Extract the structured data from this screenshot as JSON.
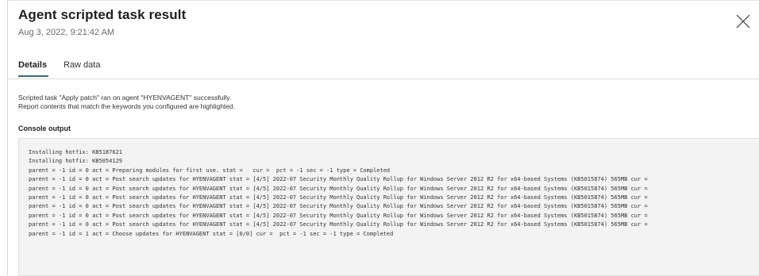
{
  "dialog": {
    "title": "Agent scripted task result",
    "timestamp": "Aug 3, 2022, 9:21:42 AM",
    "close_icon": "close-icon"
  },
  "tabs": [
    {
      "label": "Details",
      "active": true
    },
    {
      "label": "Raw data",
      "active": false
    }
  ],
  "details": {
    "message_line1": "Scripted task \"Apply patch\" ran on agent \"HYENVAGENT\" successfully.",
    "message_line2": "Report contents that match the keywords you configured are highlighted.",
    "console_label": "Console output",
    "console_lines": [
      "Installing hotfix: KB5187621",
      "Installing hotfix: KB5054129",
      "parent = -1 id = 0 act = Preparing modules for first use. stat =   cur =  pct = -1 sec = -1 type = Completed",
      "parent = -1 id = 0 act = Post search updates for HYENVAGENT stat = [4/5] 2022-07 Security Monthly Quality Rollup for Windows Server 2012 R2 for x64-based Systems (KB5015874) 565MB cur =",
      "parent = -1 id = 0 act = Post search updates for HYENVAGENT stat = [4/5] 2022-07 Security Monthly Quality Rollup for Windows Server 2012 R2 for x64-based Systems (KB5015874) 565MB cur =",
      "parent = -1 id = 0 act = Post search updates for HYENVAGENT stat = [4/5] 2022-07 Security Monthly Quality Rollup for Windows Server 2012 R2 for x64-based Systems (KB5015874) 565MB cur =",
      "parent = -1 id = 0 act = Post search updates for HYENVAGENT stat = [4/5] 2022-07 Security Monthly Quality Rollup for Windows Server 2012 R2 for x64-based Systems (KB5015874) 565MB cur =",
      "parent = -1 id = 0 act = Post search updates for HYENVAGENT stat = [4/5] 2022-07 Security Monthly Quality Rollup for Windows Server 2012 R2 for x64-based Systems (KB5015874) 565MB cur =",
      "parent = -1 id = 0 act = Post search updates for HYENVAGENT stat = [4/5] 2022-07 Security Monthly Quality Rollup for Windows Server 2012 R2 for x64-based Systems (KB5015874) 565MB cur =",
      "parent = -1 id = 1 act = Choose updates for HYENVAGENT stat = [0/0] cur =  pct = -1 sec = -1 type = Completed"
    ]
  },
  "colors": {
    "accent": "#2f6f7f",
    "console_bg": "#f3f3f3"
  }
}
